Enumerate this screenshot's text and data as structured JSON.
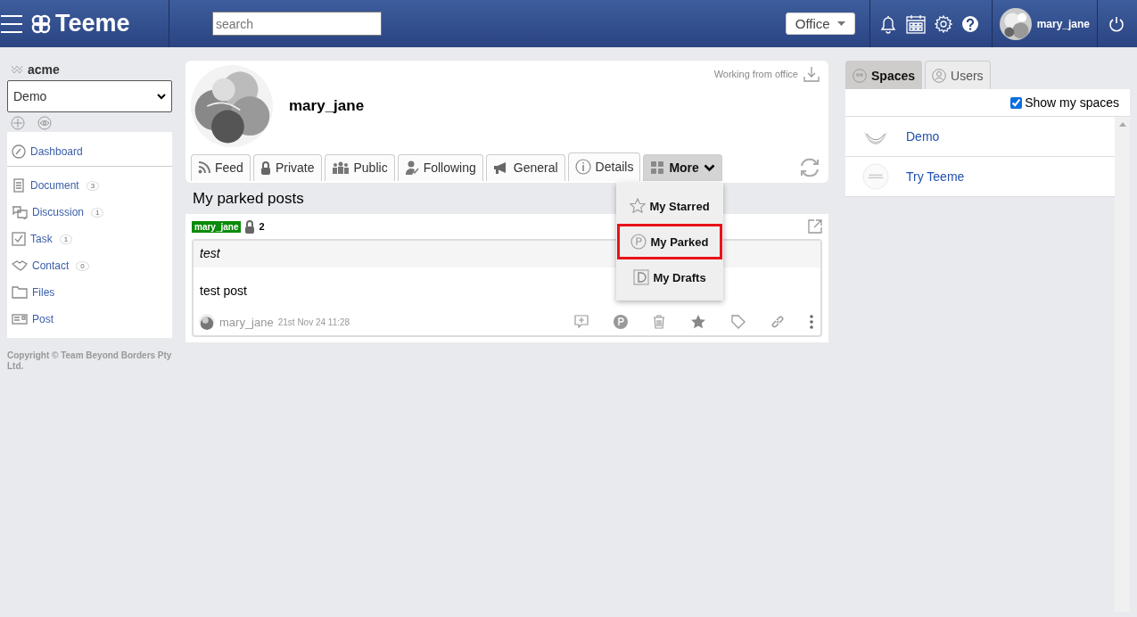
{
  "header": {
    "logo": "Teeme",
    "search": {
      "placeholder": "search"
    },
    "location": "Office",
    "user": "mary_jane"
  },
  "sidebar": {
    "org": "acme",
    "space": "Demo",
    "items": [
      {
        "kind": "dashboard",
        "label": "Dashboard"
      },
      {
        "kind": "document",
        "label": "Document",
        "count": "3"
      },
      {
        "kind": "discussion",
        "label": "Discussion",
        "count": "1"
      },
      {
        "kind": "task",
        "label": "Task",
        "count": "1"
      },
      {
        "kind": "contact",
        "label": "Contact",
        "count": "0"
      },
      {
        "kind": "files",
        "label": "Files"
      },
      {
        "kind": "post",
        "label": "Post"
      }
    ],
    "copyright": "Copyright © Team Beyond Borders Pty Ltd."
  },
  "profile": {
    "status": "Working from office",
    "name": "mary_jane",
    "tabs": [
      {
        "kind": "feed",
        "label": "Feed",
        "selected": false
      },
      {
        "kind": "private",
        "label": "Private",
        "selected": false
      },
      {
        "kind": "public",
        "label": "Public",
        "selected": false
      },
      {
        "kind": "following",
        "label": "Following",
        "selected": false
      },
      {
        "kind": "general",
        "label": "General",
        "selected": false
      },
      {
        "kind": "details",
        "label": "Details",
        "selected": false
      },
      {
        "kind": "more",
        "label": "More",
        "selected": true
      }
    ],
    "menu": [
      {
        "kind": "starred",
        "label": "My Starred",
        "selected": false
      },
      {
        "kind": "parked",
        "label": "My Parked",
        "selected": true
      },
      {
        "kind": "drafts",
        "label": "My Drafts",
        "selected": false
      }
    ]
  },
  "feed": {
    "heading": "My parked posts",
    "post": {
      "tag": "mary_jane",
      "count": "2",
      "title": "test",
      "body": "test post",
      "author": "mary_jane",
      "time": "21st Nov 24 11:28"
    }
  },
  "spaces_panel": {
    "tabs": [
      {
        "kind": "spaces",
        "label": "Spaces",
        "selected": true
      },
      {
        "kind": "users",
        "label": "Users",
        "selected": false
      }
    ],
    "show_my_spaces": {
      "label": "Show my spaces",
      "checked": true
    },
    "spaces": [
      {
        "name": "Demo"
      },
      {
        "name": "Try Teeme"
      }
    ]
  }
}
